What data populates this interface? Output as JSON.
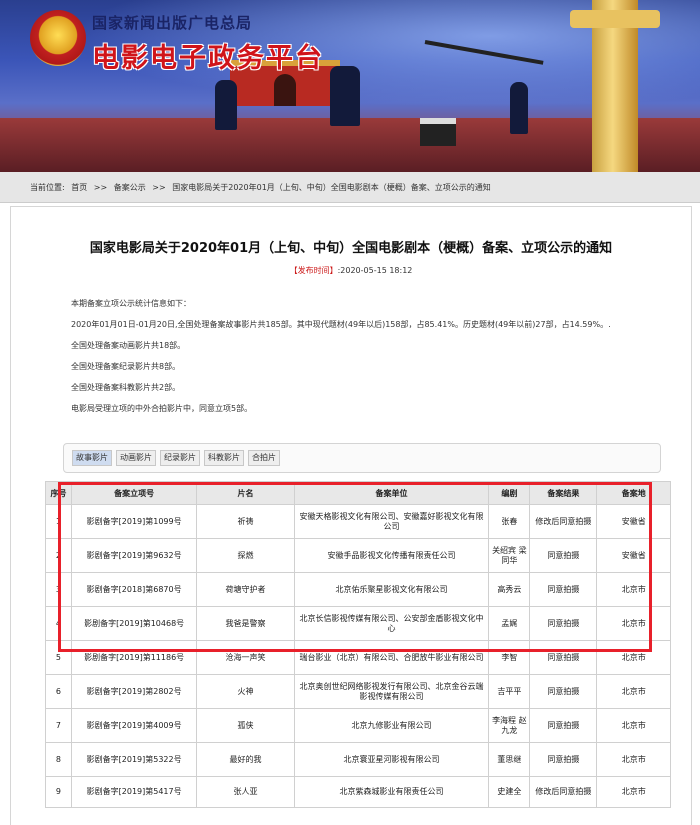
{
  "header": {
    "org_name": "国家新闻出版广电总局",
    "platform_name": "电影电子政务平台"
  },
  "breadcrumb": {
    "label": "当前位置:",
    "items": [
      "首页",
      ">>",
      "备案公示",
      ">>",
      "国家电影局关于2020年01月（上旬、中旬）全国电影剧本（梗概）备案、立项公示的通知"
    ]
  },
  "article": {
    "title": "国家电影局关于2020年01月（上旬、中旬）全国电影剧本（梗概）备案、立项公示的通知",
    "published_label": "【发布时间】",
    "published_value": ":2020-05-15 18:12",
    "paragraphs": [
      "本期备案立项公示统计信息如下：",
      "2020年01月01日-01月20日,全国处理备案故事影片共185部。其中现代题材(49年以后)158部，占85.41%。历史题材(49年以前)27部，占14.59%。.",
      "全国处理备案动画影片共18部。",
      "全国处理备案纪录影片共8部。",
      "全国处理备案科教影片共2部。",
      "电影局受理立项的中外合拍影片中，同意立项5部。"
    ]
  },
  "tabs": [
    "故事影片",
    "动画影片",
    "纪录影片",
    "科教影片",
    "合拍片"
  ],
  "table": {
    "headers": [
      "序号",
      "备案立项号",
      "片名",
      "备案单位",
      "编剧",
      "备案结果",
      "备案地"
    ],
    "rows": [
      [
        "1",
        "影剧备字[2019]第1099号",
        "祈祷",
        "安徽天格影视文化有限公司、安徽嘉好影视文化有限公司",
        "张春",
        "修改后同意拍摄",
        "安徽省"
      ],
      [
        "2",
        "影剧备字[2019]第9632号",
        "探燃",
        "安徽手品影视文化传播有限责任公司",
        "关绍宾 梁同华",
        "同意拍摄",
        "安徽省"
      ],
      [
        "3",
        "影剧备字[2018]第6870号",
        "荷塘守护者",
        "北京佑乐聚星影视文化有限公司",
        "高秀云",
        "同意拍摄",
        "北京市"
      ],
      [
        "4",
        "影剧备字[2019]第10468号",
        "我爸是警察",
        "北京长信影视传媒有限公司、公安部金盾影视文化中心",
        "孟娓",
        "同意拍摄",
        "北京市"
      ],
      [
        "5",
        "影剧备字[2019]第11186号",
        "沧海一声笑",
        "瑞台影业（北京）有限公司、合肥放牛影业有限公司",
        "李智",
        "同意拍摄",
        "北京市"
      ],
      [
        "6",
        "影剧备字[2019]第2802号",
        "火神",
        "北京奥创世纪网络影视发行有限公司、北京金谷云端影视传媒有限公司",
        "吉平平",
        "同意拍摄",
        "北京市"
      ],
      [
        "7",
        "影剧备字[2019]第4009号",
        "孤侠",
        "北京九修影业有限公司",
        "李海程 赵九龙",
        "同意拍摄",
        "北京市"
      ],
      [
        "8",
        "影剧备字[2019]第5322号",
        "最好的我",
        "北京寰亚星河影视有限公司",
        "董思继",
        "同意拍摄",
        "北京市"
      ],
      [
        "9",
        "影剧备字[2019]第5417号",
        "张人亚",
        "北京紫森城影业有限责任公司",
        "史建全",
        "修改后同意拍摄",
        "北京市"
      ]
    ]
  },
  "colors": {
    "highlight_box": "#e8202a",
    "title_red": "#d0141a",
    "breadcrumb_bg": "#e6e6e6"
  }
}
